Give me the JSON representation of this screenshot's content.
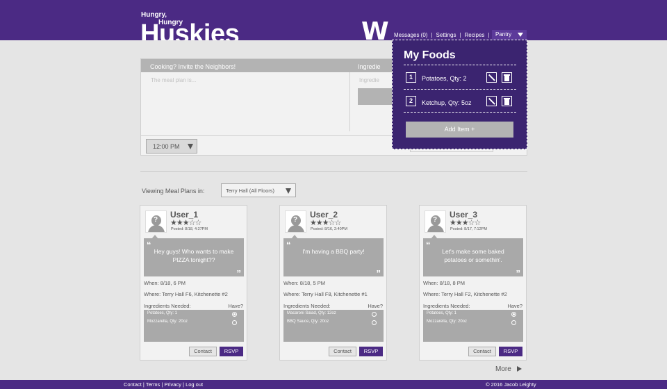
{
  "header": {
    "logo_line1": "Hungry,",
    "logo_line2": "Hungry",
    "logo_line3": "Huskies",
    "w_mark": "W",
    "nav": [
      "Messages (0)",
      "Settings",
      "Recipes",
      "Pantry"
    ],
    "separator": "|"
  },
  "invite": {
    "title": "Cooking? Invite the Neighbors!",
    "ingredients_heading": "Ingredie",
    "meal_plan_placeholder": "The meal plan is...",
    "ingredients_placeholder": "Ingredie",
    "time_value": "12:00 PM"
  },
  "my_foods": {
    "title": "My Foods",
    "items": [
      {
        "num": "1",
        "label": "Potatoes, Qty: 2"
      },
      {
        "num": "2",
        "label": "Ketchup, Qty: 5oz"
      }
    ],
    "add_label": "Add Item +",
    "edit_icon": "pencil-icon",
    "delete_icon": "trash-icon"
  },
  "filter": {
    "label": "Viewing Meal Plans in:",
    "selected": "Terry Hall (All Floors)"
  },
  "cards": [
    {
      "user": "User_1",
      "stars": "★★★☆☆",
      "rating": 3,
      "posted": "Posted: 8/18, 4:37PM",
      "quote_open": "“",
      "quote_close": "”",
      "message": "Hey guys! Who wants to make PIZZA tonight??",
      "when": "When:  8/18, 6 PM",
      "where": "Where: Terry Hall F6, Kitchenette #2",
      "ingredients_label": "Ingredients Needed:",
      "have_label": "Have?",
      "ingredients": [
        {
          "name": "Potatoes, Qty: 1",
          "have": true
        },
        {
          "name": "Mozzarella, Qty: 20oz",
          "have": false
        }
      ],
      "contact": "Contact",
      "rsvp": "RSVP"
    },
    {
      "user": "User_2",
      "stars": "★★★☆☆",
      "rating": 3,
      "posted": "Posted: 8/16, 2:40PM",
      "quote_open": "“",
      "quote_close": "”",
      "message": "I'm having a BBQ party!",
      "when": "When:  8/18, 5 PM",
      "where": "Where: Terry Hall F8, Kitchenette #1",
      "ingredients_label": "Ingredients Needed:",
      "have_label": "Have?",
      "ingredients": [
        {
          "name": "Macaroni Salad, Qty: 12oz",
          "have": false
        },
        {
          "name": "BBQ Sauce, Qty: 20oz",
          "have": false
        }
      ],
      "contact": "Contact",
      "rsvp": "RSVP"
    },
    {
      "user": "User_3",
      "stars": "★★★☆☆",
      "rating": 3,
      "posted": "Posted: 8/17, 7:12PM",
      "quote_open": "“",
      "quote_close": "”",
      "message": "Let's make some baked potatoes or somethin'.",
      "when": "When:  8/18, 8 PM",
      "where": "Where: Terry Hall F2, Kitchenette #2",
      "ingredients_label": "Ingredients Needed:",
      "have_label": "Have?",
      "ingredients": [
        {
          "name": "Potatoes, Qty: 1",
          "have": true
        },
        {
          "name": "Mozzarella, Qty: 20oz",
          "have": false
        }
      ],
      "contact": "Contact",
      "rsvp": "RSVP"
    }
  ],
  "more_label": "More",
  "footer": {
    "links": "Contact | Terms | Privacy | Log out",
    "copyright": "© 2016 Jacob Leighty"
  },
  "colors": {
    "brand_purple": "#4b2a84",
    "panel_purple": "#3b2470",
    "gray": "#a9a9a9"
  }
}
